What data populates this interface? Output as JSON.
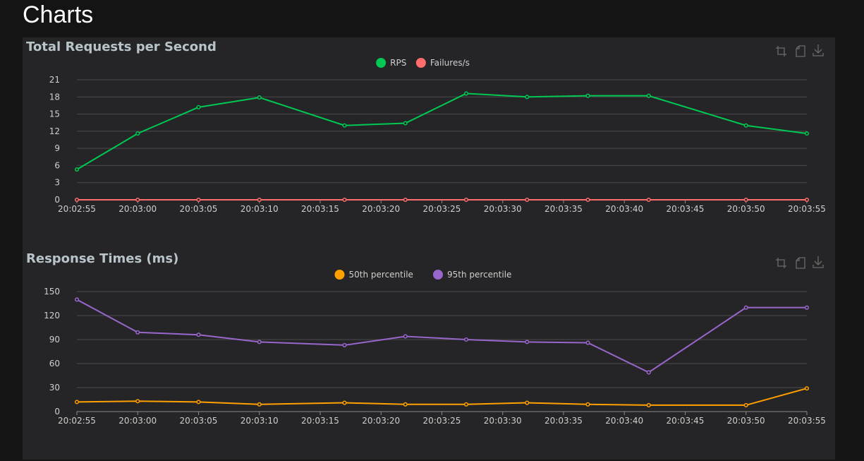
{
  "page": {
    "title": "Charts"
  },
  "toolbox": {
    "icons": [
      "zoom-icon",
      "restore-icon",
      "download-icon"
    ]
  },
  "x_ticks": [
    "20:02:55",
    "20:03:00",
    "20:03:05",
    "20:03:10",
    "20:03:15",
    "20:03:20",
    "20:03:25",
    "20:03:30",
    "20:03:35",
    "20:03:40",
    "20:03:45",
    "20:03:50",
    "20:03:55"
  ],
  "charts": [
    {
      "title": "Total Requests per Second",
      "y_ticks": [
        "0",
        "3",
        "6",
        "9",
        "12",
        "15",
        "18",
        "21"
      ]
    },
    {
      "title": "Response Times (ms)",
      "y_ticks": [
        "0",
        "30",
        "60",
        "90",
        "120",
        "150"
      ]
    }
  ],
  "chart_data": [
    {
      "type": "line",
      "title": "Total Requests per Second",
      "x": [
        "20:02:55",
        "20:03:00",
        "20:03:05",
        "20:03:10",
        "20:03:17",
        "20:03:22",
        "20:03:27",
        "20:03:32",
        "20:03:37",
        "20:03:42",
        "20:03:50",
        "20:03:55"
      ],
      "xlim": [
        "20:02:55",
        "20:03:55"
      ],
      "ylim": [
        0,
        21
      ],
      "grid": true,
      "legend": "top-center",
      "series": [
        {
          "name": "RPS",
          "color": "#00c853",
          "values": [
            5.3,
            11.6,
            16.2,
            17.9,
            13.0,
            13.4,
            18.6,
            18.0,
            18.2,
            18.2,
            13.0,
            11.6
          ]
        },
        {
          "name": "Failures/s",
          "color": "#ff6d6d",
          "values": [
            0,
            0,
            0,
            0,
            0,
            0,
            0,
            0,
            0,
            0,
            0,
            0
          ]
        }
      ]
    },
    {
      "type": "line",
      "title": "Response Times (ms)",
      "x": [
        "20:02:55",
        "20:03:00",
        "20:03:05",
        "20:03:10",
        "20:03:17",
        "20:03:22",
        "20:03:27",
        "20:03:32",
        "20:03:37",
        "20:03:42",
        "20:03:50",
        "20:03:55"
      ],
      "xlim": [
        "20:02:55",
        "20:03:55"
      ],
      "ylim": [
        0,
        150
      ],
      "grid": true,
      "legend": "top-center",
      "series": [
        {
          "name": "50th percentile",
          "color": "#ff9f00",
          "values": [
            12,
            13,
            12,
            9,
            11,
            9,
            9,
            11,
            9,
            8,
            8,
            29
          ]
        },
        {
          "name": "95th percentile",
          "color": "#9966cc",
          "values": [
            140,
            99,
            96,
            87,
            83,
            94,
            90,
            87,
            86,
            49,
            130,
            130
          ]
        }
      ]
    }
  ]
}
